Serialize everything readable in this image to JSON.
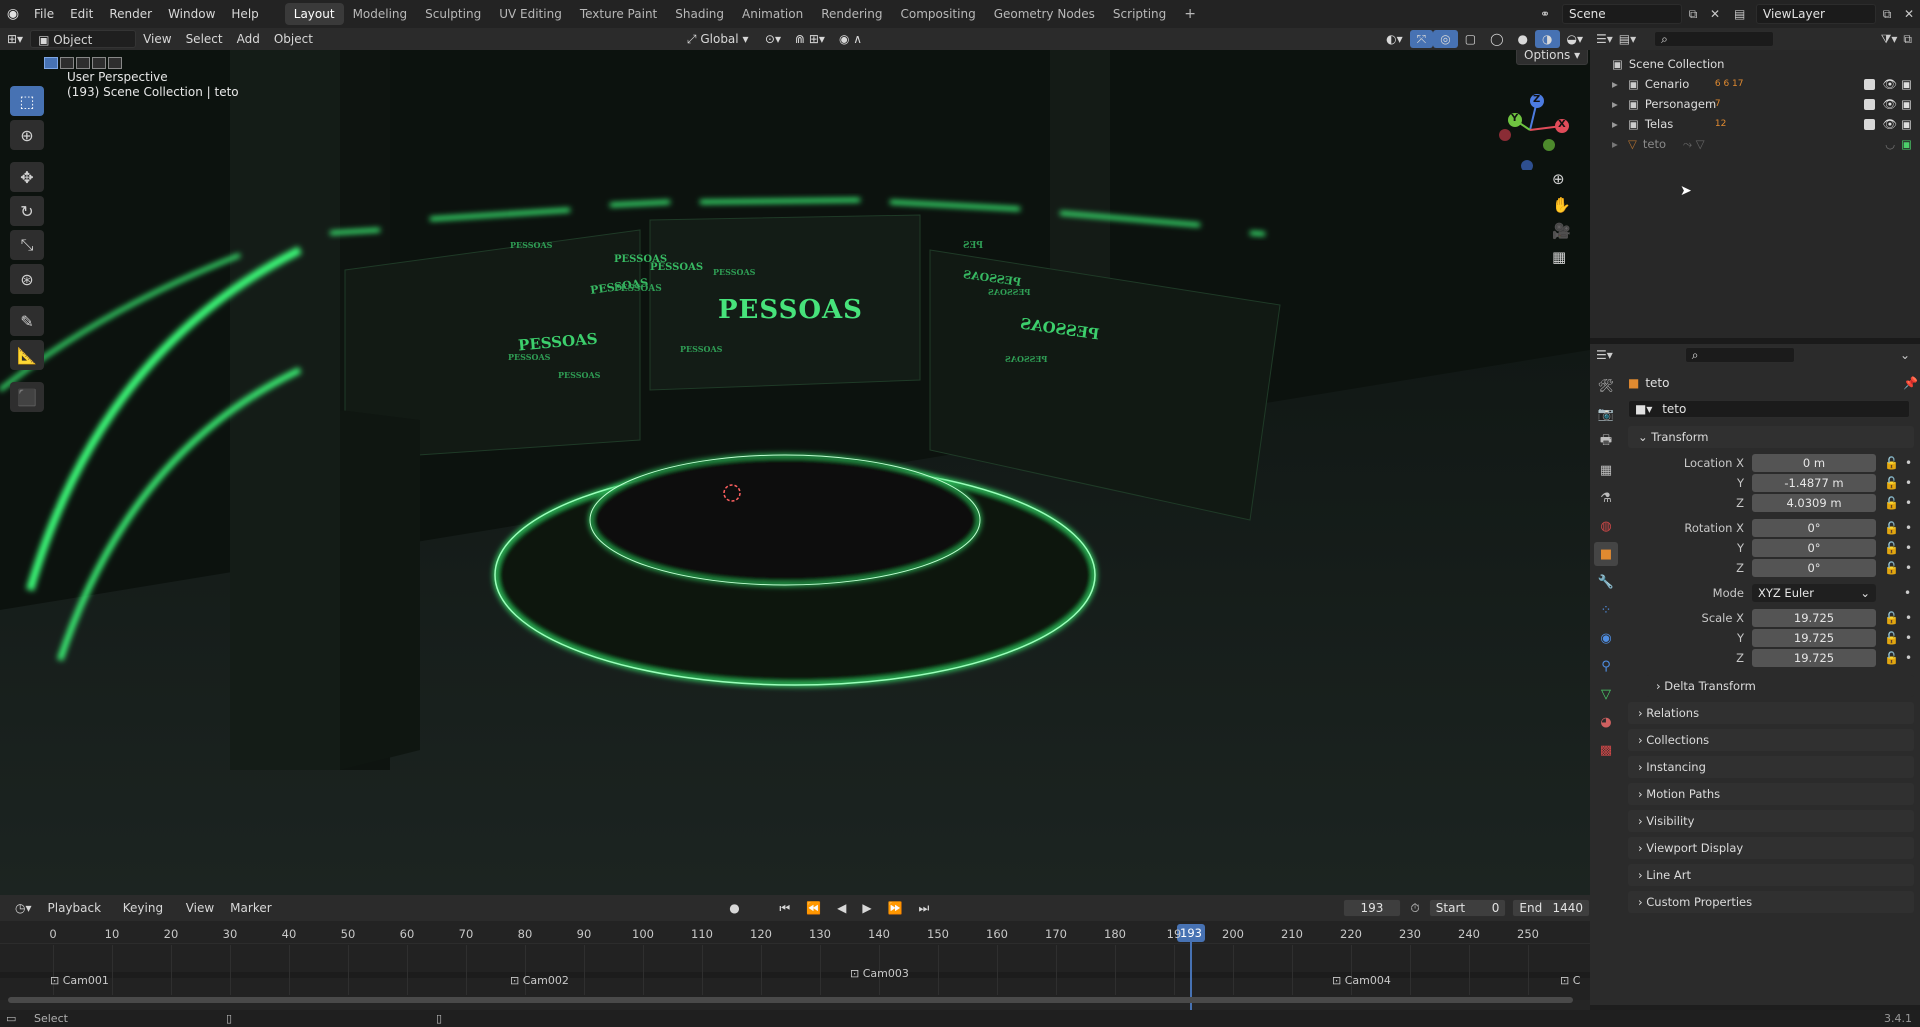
{
  "topbar": {
    "menus": [
      "File",
      "Edit",
      "Render",
      "Window",
      "Help"
    ],
    "workspaces": [
      "Layout",
      "Modeling",
      "Sculpting",
      "UV Editing",
      "Texture Paint",
      "Shading",
      "Animation",
      "Rendering",
      "Compositing",
      "Geometry Nodes",
      "Scripting"
    ],
    "active_workspace": "Layout",
    "scene": "Scene",
    "view_layer": "ViewLayer"
  },
  "viewport": {
    "mode": "Object Mode",
    "menus": [
      "View",
      "Select",
      "Add",
      "Object"
    ],
    "orientation": "Global",
    "options_label": "Options",
    "info_line1": "User Perspective",
    "info_line2": "(193) Scene Collection | teto",
    "gizmo": {
      "z": "Z",
      "y": "Y",
      "x": "X"
    },
    "screen_texts": [
      "PESSOAS",
      "PESSOAS",
      "PESSOAS",
      "PESSOAS",
      "PESSOAS",
      "PESSOAS",
      "PESSOAS",
      "PESSOAS",
      "PESSOAS",
      "PESSOAS",
      "PESSOAS",
      "PESSOAS",
      "PESSOAS",
      "PESSOAS",
      "PESSOAS",
      "PES"
    ]
  },
  "outliner": {
    "root": "Scene Collection",
    "items": [
      {
        "label": "Cenario",
        "badges": "6  6 17"
      },
      {
        "label": "Personagem",
        "badges": "7"
      },
      {
        "label": "Telas",
        "badges": "12"
      },
      {
        "label": "teto",
        "badges": ""
      }
    ]
  },
  "properties": {
    "object_name": "teto",
    "datablock": "teto",
    "transform_title": "Transform",
    "location": {
      "label": "Location X",
      "x": "0 m",
      "y": "-1.4877 m",
      "z": "4.0309 m"
    },
    "rotation": {
      "label": "Rotation X",
      "x": "0°",
      "y": "0°",
      "z": "0°"
    },
    "mode_label": "Mode",
    "mode_value": "XYZ Euler",
    "scale": {
      "label": "Scale X",
      "x": "19.725",
      "y": "19.725",
      "z": "19.725"
    },
    "axis_y": "Y",
    "axis_z": "Z",
    "delta_transform": "Delta Transform",
    "panels": [
      "Relations",
      "Collections",
      "Instancing",
      "Motion Paths",
      "Visibility",
      "Viewport Display",
      "Line Art",
      "Custom Properties"
    ]
  },
  "timeline": {
    "menus": [
      "Playback",
      "Keying",
      "View",
      "Marker"
    ],
    "current_frame": "193",
    "start_label": "Start",
    "start_value": "0",
    "end_label": "End",
    "end_value": "1440",
    "ticks": [
      "0",
      "10",
      "20",
      "30",
      "40",
      "50",
      "60",
      "70",
      "80",
      "90",
      "100",
      "110",
      "120",
      "130",
      "140",
      "150",
      "160",
      "170",
      "180",
      "19",
      "200",
      "210",
      "220",
      "230",
      "240",
      "250"
    ],
    "playhead_label": "193",
    "markers": [
      "Cam001",
      "Cam002",
      "Cam003",
      "Cam004",
      "C"
    ]
  },
  "statusbar": {
    "left": "Select",
    "version": "3.4.1"
  },
  "colors": {
    "accent": "#4772b3",
    "neon": "#3dff7a",
    "object_orange": "#e08a30"
  }
}
